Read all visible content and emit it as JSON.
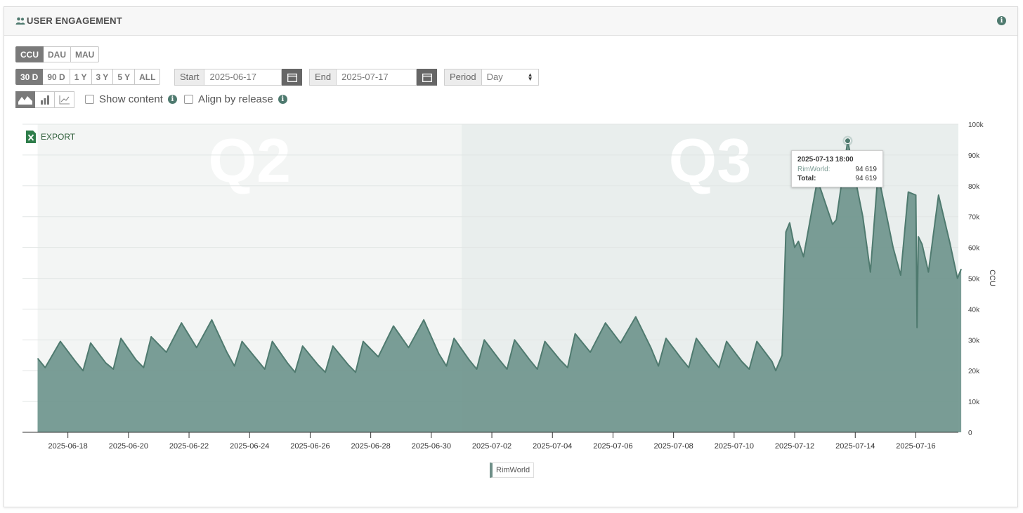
{
  "header": {
    "title": "USER ENGAGEMENT"
  },
  "metric_tabs": [
    {
      "label": "CCU",
      "active": true
    },
    {
      "label": "DAU",
      "active": false
    },
    {
      "label": "MAU",
      "active": false
    }
  ],
  "range_tabs": [
    {
      "label": "30 D",
      "active": true
    },
    {
      "label": "90 D",
      "active": false
    },
    {
      "label": "1 Y",
      "active": false
    },
    {
      "label": "3 Y",
      "active": false
    },
    {
      "label": "5 Y",
      "active": false
    },
    {
      "label": "ALL",
      "active": false
    }
  ],
  "start": {
    "label": "Start",
    "value": "2025-06-17"
  },
  "end": {
    "label": "End",
    "value": "2025-07-17"
  },
  "period": {
    "label": "Period",
    "value": "Day"
  },
  "chart_types": [
    {
      "icon": "area-chart-icon",
      "active": true
    },
    {
      "icon": "bar-chart-icon",
      "active": false
    },
    {
      "icon": "line-chart-icon",
      "active": false
    }
  ],
  "options": {
    "show_content": "Show content",
    "align_by_release": "Align by release"
  },
  "export_label": "EXPORT",
  "tooltip": {
    "date": "2025-07-13 18:00",
    "series_label": "RimWorld:",
    "series_value": "94 619",
    "total_label": "Total:",
    "total_value": "94 619"
  },
  "colors": {
    "series": "#6f958d",
    "series_line": "#4f7a6f",
    "accent": "#4f7a6f"
  },
  "chart_data": {
    "type": "area",
    "ylabel": "CCU",
    "ylim": [
      0,
      100000
    ],
    "yticks": [
      "0",
      "10k",
      "20k",
      "30k",
      "40k",
      "50k",
      "60k",
      "70k",
      "80k",
      "90k",
      "100k"
    ],
    "xticks": [
      "2025-06-18",
      "2025-06-20",
      "2025-06-22",
      "2025-06-24",
      "2025-06-26",
      "2025-06-28",
      "2025-06-30",
      "2025-07-02",
      "2025-07-04",
      "2025-07-06",
      "2025-07-08",
      "2025-07-10",
      "2025-07-12",
      "2025-07-14",
      "2025-07-16"
    ],
    "bands": [
      {
        "label": "Q2",
        "from": "2025-06-17",
        "to": "2025-07-01"
      },
      {
        "label": "Q3",
        "from": "2025-07-01",
        "to": "2025-07-18"
      }
    ],
    "series": [
      {
        "name": "RimWorld",
        "points": [
          [
            "2025-06-17 00:00",
            24000
          ],
          [
            "2025-06-17 06:00",
            21000
          ],
          [
            "2025-06-17 18:00",
            29500
          ],
          [
            "2025-06-18 06:00",
            23000
          ],
          [
            "2025-06-18 12:00",
            20000
          ],
          [
            "2025-06-18 18:00",
            29000
          ],
          [
            "2025-06-19 06:00",
            22500
          ],
          [
            "2025-06-19 12:00",
            20500
          ],
          [
            "2025-06-19 18:00",
            30500
          ],
          [
            "2025-06-20 06:00",
            23500
          ],
          [
            "2025-06-20 12:00",
            21000
          ],
          [
            "2025-06-20 18:00",
            31000
          ],
          [
            "2025-06-21 06:00",
            26000
          ],
          [
            "2025-06-21 18:00",
            35500
          ],
          [
            "2025-06-22 06:00",
            27500
          ],
          [
            "2025-06-22 18:00",
            36500
          ],
          [
            "2025-06-23 06:00",
            26000
          ],
          [
            "2025-06-23 12:00",
            21500
          ],
          [
            "2025-06-23 18:00",
            29500
          ],
          [
            "2025-06-24 06:00",
            23500
          ],
          [
            "2025-06-24 12:00",
            20500
          ],
          [
            "2025-06-24 18:00",
            29500
          ],
          [
            "2025-06-25 06:00",
            22500
          ],
          [
            "2025-06-25 12:00",
            19500
          ],
          [
            "2025-06-25 18:00",
            28000
          ],
          [
            "2025-06-26 06:00",
            22000
          ],
          [
            "2025-06-26 12:00",
            19500
          ],
          [
            "2025-06-26 18:00",
            28000
          ],
          [
            "2025-06-27 06:00",
            22000
          ],
          [
            "2025-06-27 12:00",
            19500
          ],
          [
            "2025-06-27 18:00",
            29500
          ],
          [
            "2025-06-28 06:00",
            24500
          ],
          [
            "2025-06-28 18:00",
            34500
          ],
          [
            "2025-06-29 06:00",
            27500
          ],
          [
            "2025-06-29 18:00",
            36500
          ],
          [
            "2025-06-30 06:00",
            25500
          ],
          [
            "2025-06-30 12:00",
            21500
          ],
          [
            "2025-06-30 18:00",
            30500
          ],
          [
            "2025-07-01 06:00",
            23500
          ],
          [
            "2025-07-01 12:00",
            20500
          ],
          [
            "2025-07-01 18:00",
            30000
          ],
          [
            "2025-07-02 06:00",
            23500
          ],
          [
            "2025-07-02 12:00",
            20500
          ],
          [
            "2025-07-02 18:00",
            30000
          ],
          [
            "2025-07-03 06:00",
            23500
          ],
          [
            "2025-07-03 12:00",
            20500
          ],
          [
            "2025-07-03 18:00",
            29500
          ],
          [
            "2025-07-04 06:00",
            23500
          ],
          [
            "2025-07-04 12:00",
            21000
          ],
          [
            "2025-07-04 18:00",
            32000
          ],
          [
            "2025-07-05 06:00",
            26000
          ],
          [
            "2025-07-05 18:00",
            35500
          ],
          [
            "2025-07-06 06:00",
            29000
          ],
          [
            "2025-07-06 18:00",
            37500
          ],
          [
            "2025-07-07 06:00",
            27500
          ],
          [
            "2025-07-07 12:00",
            21500
          ],
          [
            "2025-07-07 18:00",
            30500
          ],
          [
            "2025-07-08 06:00",
            24000
          ],
          [
            "2025-07-08 12:00",
            21000
          ],
          [
            "2025-07-08 18:00",
            30500
          ],
          [
            "2025-07-09 06:00",
            24000
          ],
          [
            "2025-07-09 12:00",
            21000
          ],
          [
            "2025-07-09 18:00",
            29500
          ],
          [
            "2025-07-10 06:00",
            23000
          ],
          [
            "2025-07-10 12:00",
            20500
          ],
          [
            "2025-07-10 18:00",
            29500
          ],
          [
            "2025-07-11 06:00",
            23000
          ],
          [
            "2025-07-11 09:00",
            20000
          ],
          [
            "2025-07-11 14:00",
            25000
          ],
          [
            "2025-07-11 17:00",
            65000
          ],
          [
            "2025-07-11 20:00",
            68000
          ],
          [
            "2025-07-12 00:00",
            60000
          ],
          [
            "2025-07-12 03:00",
            62000
          ],
          [
            "2025-07-12 07:00",
            57000
          ],
          [
            "2025-07-12 18:00",
            82000
          ],
          [
            "2025-07-13 06:00",
            67500
          ],
          [
            "2025-07-13 09:00",
            69000
          ],
          [
            "2025-07-13 18:00",
            94619
          ],
          [
            "2025-07-14 06:00",
            70000
          ],
          [
            "2025-07-14 12:00",
            52000
          ],
          [
            "2025-07-14 18:00",
            84000
          ],
          [
            "2025-07-15 06:00",
            60000
          ],
          [
            "2025-07-15 12:00",
            51000
          ],
          [
            "2025-07-15 18:00",
            78000
          ],
          [
            "2025-07-16 00:00",
            77000
          ],
          [
            "2025-07-16 01:00",
            34000
          ],
          [
            "2025-07-16 02:00",
            63500
          ],
          [
            "2025-07-16 05:00",
            61000
          ],
          [
            "2025-07-16 10:00",
            52000
          ],
          [
            "2025-07-16 18:00",
            77000
          ],
          [
            "2025-07-17 03:00",
            61500
          ],
          [
            "2025-07-17 09:00",
            50000
          ],
          [
            "2025-07-17 12:00",
            53000
          ]
        ]
      }
    ]
  }
}
